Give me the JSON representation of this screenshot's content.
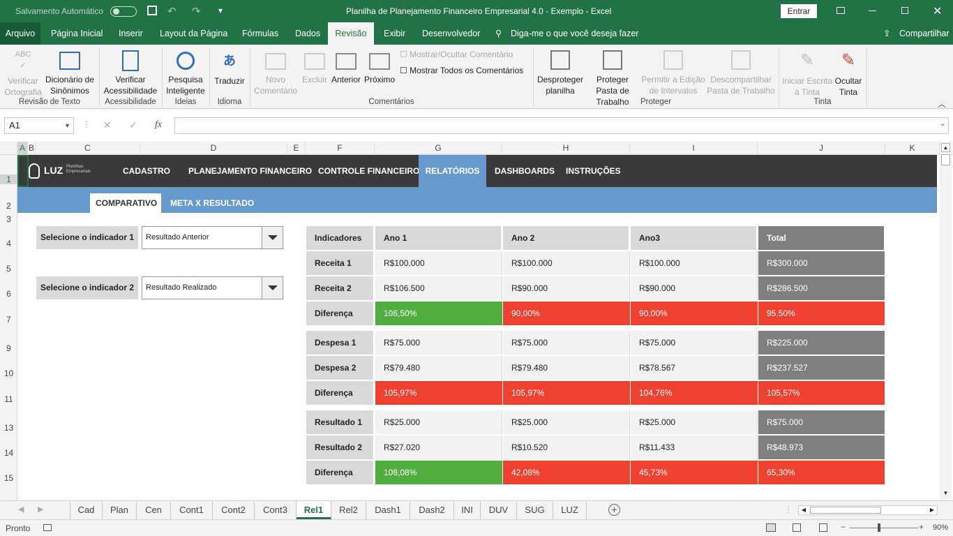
{
  "window": {
    "autosave_label": "Salvamento Automático",
    "title": "Planilha de Planejamento Financeiro Empresarial 4.0 - Exemplo  -  Excel",
    "login_button": "Entrar"
  },
  "menu": {
    "items": [
      "Arquivo",
      "Página Inicial",
      "Inserir",
      "Layout da Página",
      "Fórmulas",
      "Dados",
      "Revisão",
      "Exibir",
      "Desenvolvedor"
    ],
    "tell_me": "Diga-me o que você deseja fazer",
    "share": "Compartilhar"
  },
  "ribbon": {
    "buttons": {
      "spelling": "Verificar Ortografia",
      "thesaurus": "Dicionário de Sinônimos",
      "accessibility": "Verificar Acessibilidade",
      "smart_lookup": "Pesquisa Inteligente",
      "translate": "Traduzir",
      "new_comment": "Novo Comentário",
      "delete": "Excluir",
      "previous": "Anterior",
      "next": "Próximo",
      "show_hide_comment": "Mostrar/Ocultar Comentário",
      "show_all_comments": "Mostrar Todos os Comentários",
      "unprotect_sheet": "Desproteger planilha",
      "protect_workbook": "Proteger Pasta de Trabalho",
      "allow_edit_ranges": "Permitir a Edição de Intervalos",
      "unshare_workbook": "Descompartilhar Pasta de Trabalho",
      "start_inking": "Iniciar Escrita à Tinta",
      "hide_ink": "Ocultar Tinta"
    },
    "groups": {
      "proofing": "Revisão de Texto",
      "accessibility": "Acessibilidade",
      "insights": "Ideias",
      "language": "Idioma",
      "comments": "Comentários",
      "protect": "Proteger",
      "ink": "Tinta"
    }
  },
  "formula_bar": {
    "name_box": "A1",
    "fx": "fx",
    "value": ""
  },
  "columns": [
    "A",
    "B",
    "C",
    "D",
    "E",
    "F",
    "G",
    "H",
    "I",
    "J",
    "K"
  ],
  "rows": [
    "1",
    "2",
    "3",
    "4",
    "5",
    "6",
    "7",
    "9",
    "10",
    "11",
    "13",
    "14",
    "15"
  ],
  "sheet": {
    "logo_text": "LUZ",
    "logo_sub": "Planilhas Empresariais",
    "nav": [
      "CADASTRO",
      "PLANEJAMENTO FINANCEIRO",
      "CONTROLE FINANCEIRO",
      "RELATÓRIOS",
      "DASHBOARDS",
      "INSTRUÇÕES"
    ],
    "subtabs": [
      "COMPARATIVO",
      "META X RESULTADO"
    ],
    "selector1": {
      "label": "Selecione o indicador 1",
      "value": "Resultado Anterior"
    },
    "selector2": {
      "label": "Selecione o indicador 2",
      "value": "Resultado Realizado"
    },
    "table": {
      "headers": [
        "Indicadores",
        "Ano 1",
        "Ano 2",
        "Ano3",
        "Total"
      ],
      "rows": [
        {
          "label": "Receita 1",
          "values": [
            "R$100.000",
            "R$100.000",
            "R$100.000"
          ],
          "total": "R$300.000"
        },
        {
          "label": "Receita 2",
          "values": [
            "R$106.500",
            "R$90.000",
            "R$90.000"
          ],
          "total": "R$286.500"
        },
        {
          "label": "Diferença",
          "values": [
            "106,50%",
            "90,00%",
            "90,00%"
          ],
          "total": "95,50%"
        },
        {
          "label": "Despesa 1",
          "values": [
            "R$75.000",
            "R$75.000",
            "R$75.000"
          ],
          "total": "R$225.000"
        },
        {
          "label": "Despesa 2",
          "values": [
            "R$79.480",
            "R$79.480",
            "R$78.567"
          ],
          "total": "R$237.527"
        },
        {
          "label": "Diferença",
          "values": [
            "105,97%",
            "105,97%",
            "104,76%"
          ],
          "total": "105,57%"
        },
        {
          "label": "Resultado 1",
          "values": [
            "R$25.000",
            "R$25.000",
            "R$25.000"
          ],
          "total": "R$75.000"
        },
        {
          "label": "Resultado 2",
          "values": [
            "R$27.020",
            "R$10.520",
            "R$11.433"
          ],
          "total": "R$48.973"
        },
        {
          "label": "Diferença",
          "values": [
            "108,08%",
            "42,08%",
            "45,73%"
          ],
          "total": "65,30%"
        }
      ],
      "colors": {
        "green": "#4fae3d",
        "red": "#ee4130"
      }
    }
  },
  "sheet_tabs": [
    "Cad",
    "Plan",
    "Cen",
    "Cont1",
    "Cont2",
    "Cont3",
    "Rel1",
    "Rel2",
    "Dash1",
    "Dash2",
    "INI",
    "DUV",
    "SUG",
    "LUZ"
  ],
  "active_tab": "Rel1",
  "status": {
    "ready": "Pronto",
    "zoom": "90%"
  }
}
